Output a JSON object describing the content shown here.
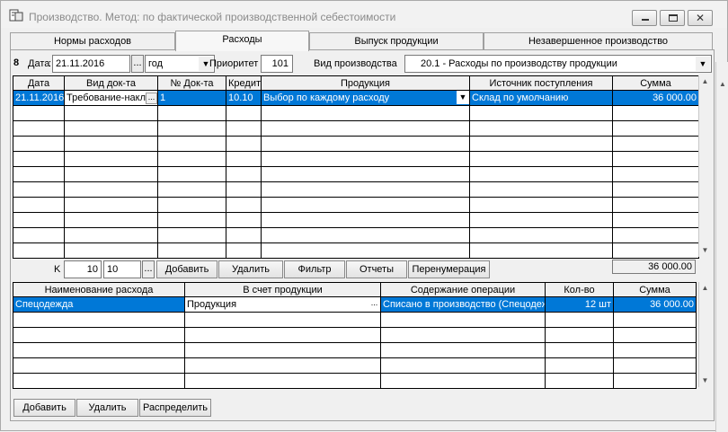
{
  "window": {
    "title": "Производство. Метод: по фактической производственной себестоимости",
    "buttons": {
      "minimize": "minimize-icon",
      "maximize": "maximize-icon",
      "close": "close-icon"
    }
  },
  "tabs": [
    {
      "label": "Нормы расходов",
      "active": false
    },
    {
      "label": "Расходы",
      "active": true
    },
    {
      "label": "Выпуск продукции",
      "active": false
    },
    {
      "label": "Незавершенное производство",
      "active": false
    }
  ],
  "filters": {
    "row_number": "8",
    "date_label": "Дата",
    "date_value": "21.11.2016",
    "date_btn": "...",
    "period_value": "год",
    "priority_label": "Приоритет",
    "priority_value": "101",
    "production_type_label": "Вид производства",
    "production_type_value": "20.1  - Расходы по производству продукции"
  },
  "top_grid": {
    "columns": [
      "Дата",
      "Вид док-та",
      "№ Док-та",
      "Кредит",
      "Продукция",
      "Источник поступления",
      "Сумма"
    ],
    "rows": [
      [
        "21.11.2016",
        "Требование-накл",
        "1",
        "10.10",
        "Выбор по каждому расходу",
        "Склад по умолчанию",
        "36 000.00"
      ]
    ],
    "empty_rows": 10,
    "total": "36 000.00"
  },
  "toolbar": {
    "k_label": "K",
    "k_value1": "10",
    "k_value2": "10",
    "k_btn": "...",
    "add": "Добавить",
    "delete": "Удалить",
    "filter": "Фильтр",
    "reports": "Отчеты",
    "renumber": "Перенумерация"
  },
  "bottom_grid": {
    "columns": [
      "Наименование расхода",
      "В счет продукции",
      "Содержание операции",
      "Кол-во",
      "Сумма"
    ],
    "rows": [
      [
        "Спецодежда",
        "Продукция",
        "Списано в производство (Спецодеж",
        "12 шт",
        "36 000.00"
      ]
    ],
    "empty_rows": 5
  },
  "bottom_buttons": {
    "add": "Добавить",
    "delete": "Удалить",
    "distribute": "Распределить"
  },
  "colors": {
    "selection": "#0078d7",
    "window_bg": "#f0f0f0"
  }
}
